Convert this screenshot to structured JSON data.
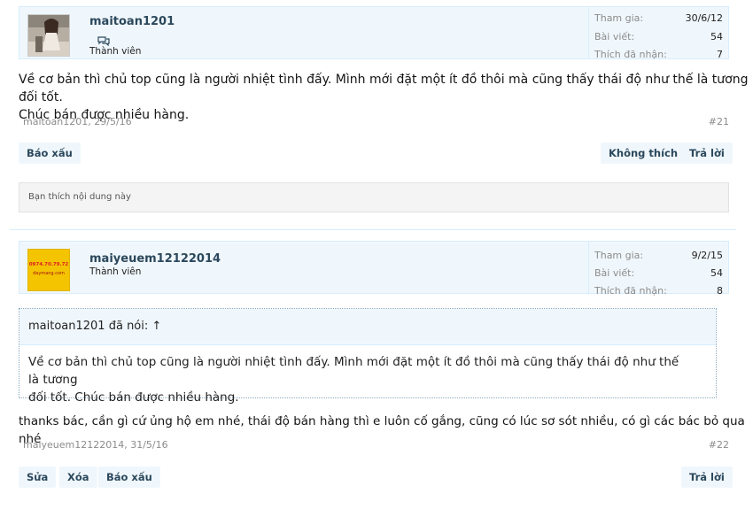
{
  "posts": [
    {
      "username": "maitoan1201",
      "user_title": "Thành viên",
      "extras": [
        {
          "label": "Tham gia:",
          "value": "30/6/12"
        },
        {
          "label": "Bài viết:",
          "value": "54"
        },
        {
          "label": "Thích đã nhận:",
          "value": "7"
        }
      ],
      "message_line1": "Về cơ bản thì chủ top cũng là người nhiệt tình đấy. Mình mới đặt một ít đồ thôi mà cũng thấy thái độ như thế là tương đối tốt.",
      "message_line2": "Chúc bán được nhiều hàng.",
      "meta": "maitoan1201, 29/5/16",
      "post_number": "#21",
      "buttons": {
        "report": "Báo xấu",
        "unlike": "Không thích",
        "reply": "Trả lời"
      },
      "likes_summary": "Bạn thích nội dung này"
    },
    {
      "username": "maiyeuem12122014",
      "user_title": "Thành viên",
      "avatar_text1": "0974.70.79.72",
      "avatar_text2": "daymang.com",
      "extras": [
        {
          "label": "Tham gia:",
          "value": "9/2/15"
        },
        {
          "label": "Bài viết:",
          "value": "54"
        },
        {
          "label": "Thích đã nhận:",
          "value": "8"
        }
      ],
      "quote": {
        "header": "maitoan1201 đã nói: ↑",
        "line1": "Về cơ bản thì chủ top cũng là người nhiệt tình đấy. Mình mới đặt một ít đồ thôi mà cũng thấy thái độ như thế là tương",
        "line2": "đối tốt. Chúc bán được nhiều hàng."
      },
      "message": "thanks bác, cần gì cứ ủng hộ em nhé, thái độ bán hàng thì e luôn cố gắng, cũng có lúc sơ sót nhiều, có gì các bác bỏ qua nhé",
      "meta": "maiyeuem12122014, 31/5/16",
      "post_number": "#22",
      "buttons": {
        "edit": "Sửa",
        "delete": "Xóa",
        "report": "Báo xấu",
        "reply": "Trả lời"
      }
    }
  ],
  "icons": {
    "online": "chat-bubbles-icon"
  },
  "colors": {
    "accent": "#2b485c",
    "userbar_bg": "#f0f7fc",
    "muted": "#8b8b8b",
    "avatar2_bg": "#f5c400"
  }
}
